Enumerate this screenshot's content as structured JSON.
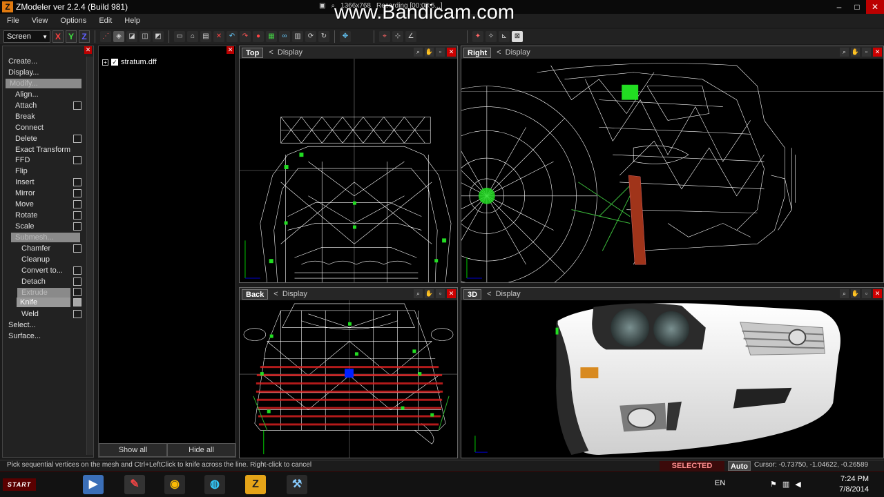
{
  "window": {
    "icon": "Z",
    "title": "ZModeler ver 2.2.4 (Build 981)",
    "recording_res": "1366x768",
    "recording_status": "Recording [00:08:5...]",
    "watermark": "www.Bandicam.com"
  },
  "menu": [
    "File",
    "View",
    "Options",
    "Edit",
    "Help"
  ],
  "toolbar": {
    "mode_select": "Screen",
    "axes": [
      "X",
      "Y",
      "Z"
    ]
  },
  "command_panel": {
    "items": [
      {
        "label": "Create...",
        "indent": 0,
        "checkbox": false
      },
      {
        "label": "Display...",
        "indent": 0,
        "checkbox": false
      },
      {
        "label": "Align...",
        "indent": 1,
        "checkbox": false
      },
      {
        "label": "Attach",
        "indent": 1,
        "checkbox": true
      },
      {
        "label": "Break",
        "indent": 1,
        "checkbox": false
      },
      {
        "label": "Connect",
        "indent": 1,
        "checkbox": false
      },
      {
        "label": "Delete",
        "indent": 1,
        "checkbox": true
      },
      {
        "label": "Exact Transform",
        "indent": 1,
        "checkbox": false
      },
      {
        "label": "FFD",
        "indent": 1,
        "checkbox": true
      },
      {
        "label": "Flip",
        "indent": 1,
        "checkbox": false
      },
      {
        "label": "Insert",
        "indent": 1,
        "checkbox": true
      },
      {
        "label": "Mirror",
        "indent": 1,
        "checkbox": true
      },
      {
        "label": "Move",
        "indent": 1,
        "checkbox": true
      },
      {
        "label": "Rotate",
        "indent": 1,
        "checkbox": true
      },
      {
        "label": "Scale",
        "indent": 1,
        "checkbox": true
      },
      {
        "label": "Chamfer",
        "indent": 2,
        "checkbox": true
      },
      {
        "label": "Cleanup",
        "indent": 2,
        "checkbox": false
      },
      {
        "label": "Convert to...",
        "indent": 2,
        "checkbox": true
      },
      {
        "label": "Detach",
        "indent": 2,
        "checkbox": true
      },
      {
        "label": "Weld",
        "indent": 2,
        "checkbox": true
      },
      {
        "label": "Select...",
        "indent": 0,
        "checkbox": false
      },
      {
        "label": "Surface...",
        "indent": 0,
        "checkbox": false
      }
    ],
    "modify_label": "Modify...",
    "submesh_label": "Submesh...",
    "extrude_label": "Extrude",
    "knife_label": "Knife"
  },
  "object_panel": {
    "file": "stratum.dff",
    "show_all": "Show all",
    "hide_all": "Hide all"
  },
  "viewports": {
    "top": {
      "name": "Top",
      "display": "Display"
    },
    "right": {
      "name": "Right",
      "display": "Display"
    },
    "back": {
      "name": "Back",
      "display": "Display"
    },
    "three_d": {
      "name": "3D",
      "display": "Display"
    }
  },
  "status": {
    "hint": "Pick sequential vertices on the mesh and Ctrl+LeftClick to knife across the line. Right-click to cancel",
    "mode": "SELECTED MODE",
    "auto": "Auto",
    "cursor": "Cursor: -0.73750, -1.04622, -0.26589"
  },
  "taskbar": {
    "start": "START",
    "lang": "EN",
    "time": "7:24 PM",
    "date": "7/8/2014"
  },
  "colors": {
    "close_red": "#cc0000",
    "vertex_green": "#22dd22",
    "selected_mode_red": "#ff8f8f"
  }
}
